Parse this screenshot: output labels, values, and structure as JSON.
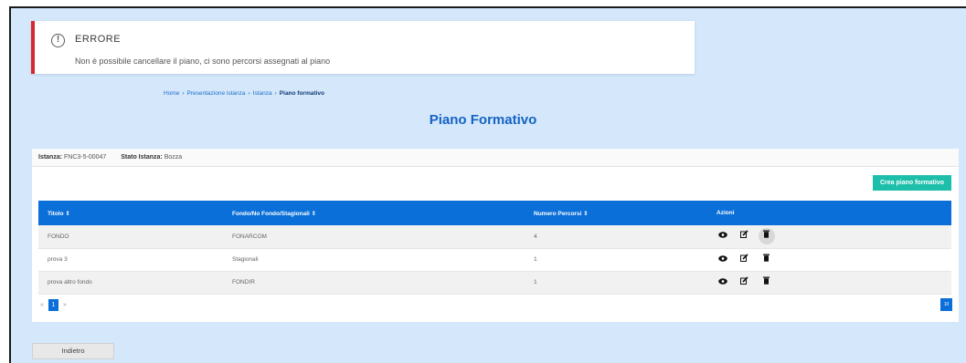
{
  "alert": {
    "icon": "exclamation-circle-icon",
    "title": "ERRORE",
    "message": "Non è possibile cancellare il piano, ci sono percorsi assegnati al piano",
    "accent_color": "#d7282f"
  },
  "breadcrumb": {
    "items": [
      "Home",
      "Presentazione istanza",
      "Istanza",
      "Piano formativo"
    ],
    "separator": "›"
  },
  "page_title": "Piano Formativo",
  "instance": {
    "istanza_label": "Istanza:",
    "istanza_value": "FNC3-5-00047",
    "stato_label": "Stato Istanza:",
    "stato_value": "Bozza"
  },
  "create_button": "Crea piano formativo",
  "table": {
    "columns": [
      "Titolo ⇕",
      "Fondo/No Fondo/Stagionali ⇕",
      "Numero Percorsi ⇕",
      "Azioni"
    ],
    "rows": [
      {
        "titolo": "FONDO",
        "fondo": "FONARCOM",
        "percorsi": "4"
      },
      {
        "titolo": "prova 3",
        "fondo": "Stagionali",
        "percorsi": "1"
      },
      {
        "titolo": "prova altro fondo",
        "fondo": "FONDIR",
        "percorsi": "1"
      }
    ],
    "action_icons": [
      "view-icon",
      "edit-icon",
      "delete-icon"
    ]
  },
  "pagination": {
    "prev": "«",
    "current_page": "1",
    "next": "»",
    "page_size": "10"
  },
  "back_button": "Indietro",
  "colors": {
    "primary": "#0a6fd8",
    "teal": "#1dbfaa",
    "background": "#d4e7fb",
    "title": "#1563c2"
  }
}
